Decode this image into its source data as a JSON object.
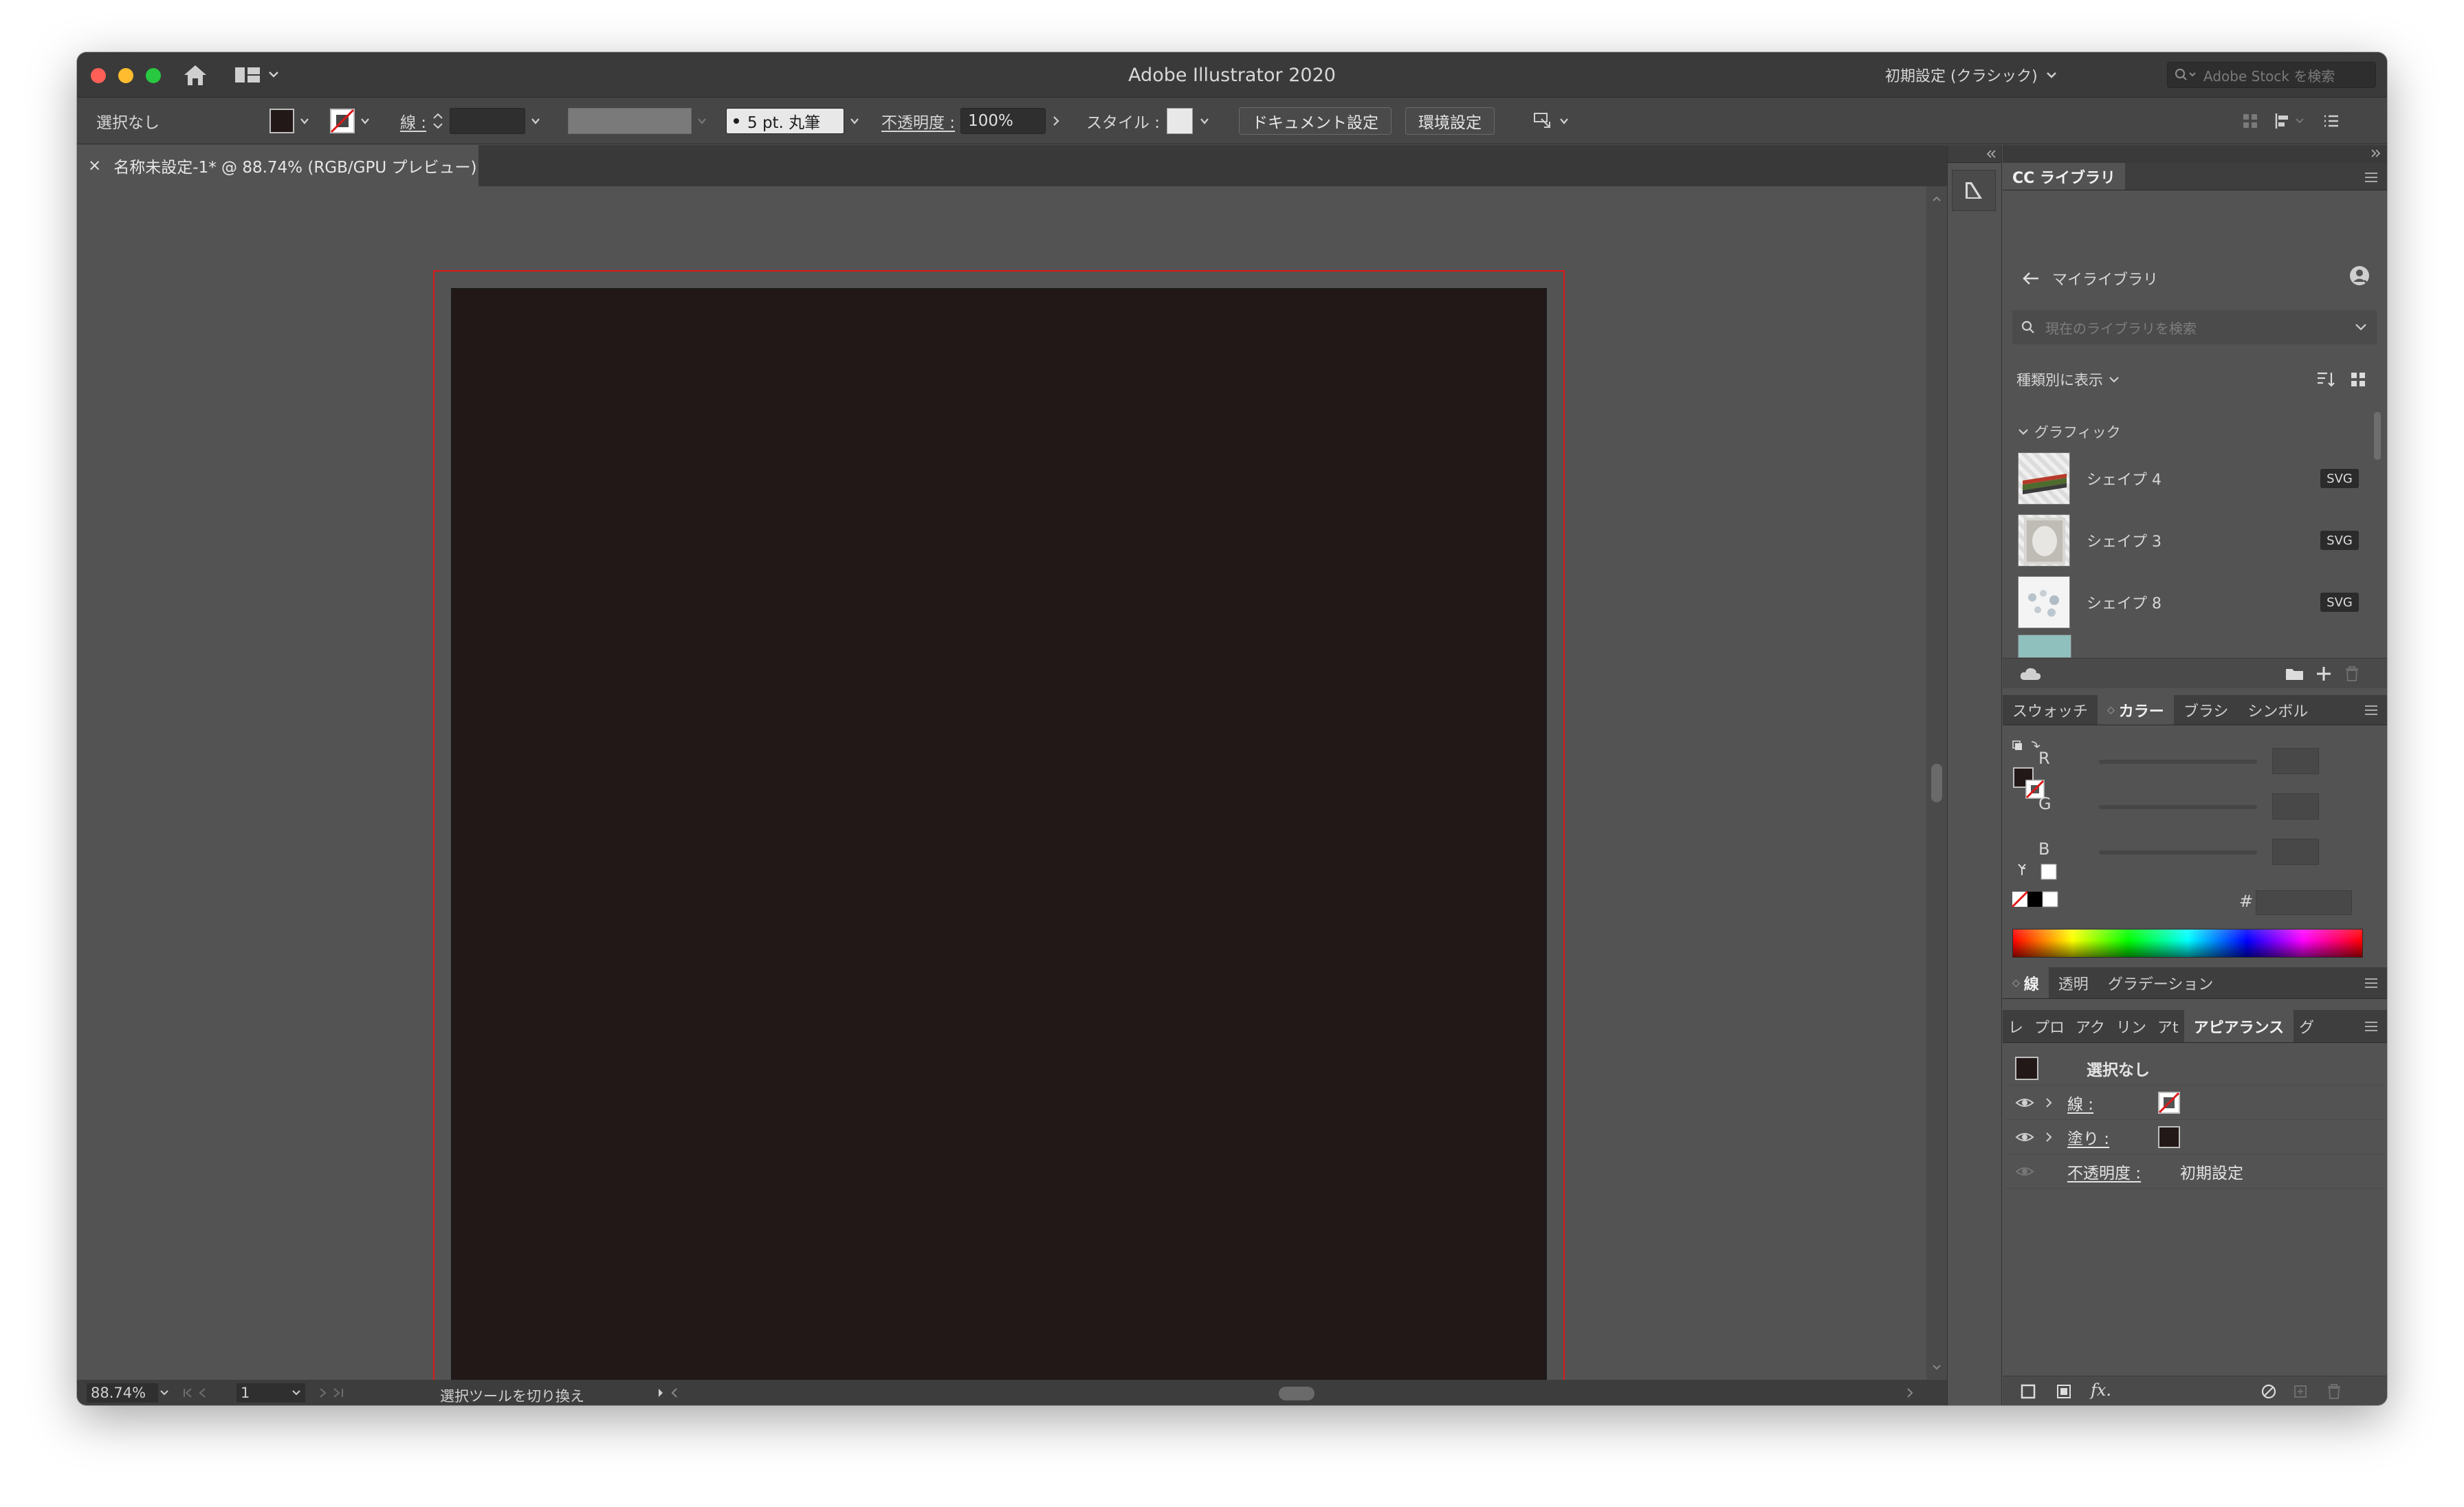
{
  "window": {
    "title": "Adobe Illustrator 2020"
  },
  "titlebar": {
    "workspace_label": "初期設定 (クラシック)",
    "stock_search_placeholder": "Adobe Stock を検索"
  },
  "control_bar": {
    "selection_status": "選択なし",
    "stroke_label": "線 :",
    "brush_label": "5 pt. 丸筆",
    "opacity_label": "不透明度 :",
    "opacity_value": "100%",
    "style_label": "スタイル :",
    "document_settings_button": "ドキュメント設定",
    "preferences_button": "環境設定"
  },
  "document": {
    "tab_title": "名称未設定-1* @ 88.74% (RGB/GPU プレビュー)",
    "close_glyph": "×",
    "artboard_color": "#231818",
    "bleed_color": "#e01818"
  },
  "status_bar": {
    "zoom": "88.74%",
    "page": "1",
    "tool_hint": "選択ツールを切り換え"
  },
  "cc_libraries": {
    "panel_title": "CC ライブラリ",
    "library_name": "マイライブラリ",
    "search_placeholder": "現在のライブラリを検索",
    "view_by_label": "種類別に表示",
    "section_label": "グラフィック",
    "items": [
      {
        "name": "シェイプ 4",
        "badge": "SVG"
      },
      {
        "name": "シェイプ 3",
        "badge": "SVG"
      },
      {
        "name": "シェイプ 8",
        "badge": "SVG"
      }
    ]
  },
  "color_panel": {
    "tabs": [
      "スウォッチ",
      "カラー",
      "ブラシ",
      "シンボル"
    ],
    "active_tab": "カラー",
    "channels": [
      "R",
      "G",
      "B"
    ],
    "hex_label": "#"
  },
  "stroke_group": {
    "tabs": [
      "線",
      "透明",
      "グラデーション"
    ]
  },
  "appearance_group": {
    "tabs": [
      "レ",
      "プロ",
      "アク",
      "リン",
      "アt",
      "アピアランス",
      "グ"
    ],
    "active_tab": "アピアランス",
    "header": "選択なし",
    "rows": [
      {
        "label": "線 :"
      },
      {
        "label": "塗り :"
      },
      {
        "label": "不透明度 :",
        "value": "初期設定"
      }
    ]
  }
}
